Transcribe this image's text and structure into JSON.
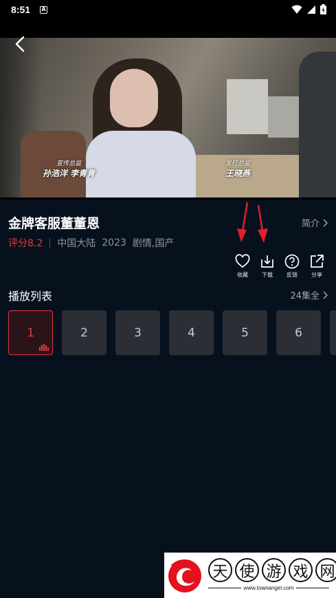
{
  "status_bar": {
    "time": "8:51",
    "notification_icon": "A",
    "icons": [
      "wifi-icon",
      "signal-icon",
      "battery-icon"
    ]
  },
  "video": {
    "credit_left": {
      "role": "宣传总监",
      "names": "孙浩洋  李青青"
    },
    "credit_right": {
      "role": "发行总监",
      "names": "王晓燕"
    }
  },
  "show": {
    "title": "金牌客服董董恩",
    "intro_label": "简介",
    "rating": "评分8.2",
    "region": "中国大陆",
    "year": "2023",
    "genre": "剧情,国产"
  },
  "actions": [
    {
      "label": "收藏",
      "icon": "heart-icon"
    },
    {
      "label": "下载",
      "icon": "download-icon"
    },
    {
      "label": "反馈",
      "icon": "help-icon"
    },
    {
      "label": "分享",
      "icon": "share-icon"
    }
  ],
  "playlist": {
    "title": "播放列表",
    "all_label": "24集全",
    "episodes": [
      "1",
      "2",
      "3",
      "4",
      "5",
      "6"
    ],
    "active_episode": "1"
  },
  "watermark": {
    "chars": [
      "天",
      "使",
      "游",
      "戏",
      "网"
    ],
    "url": "www.townangel.com"
  },
  "colors": {
    "background": "#07111e",
    "accent": "#e23b3f",
    "muted_text": "#8e95a0"
  }
}
